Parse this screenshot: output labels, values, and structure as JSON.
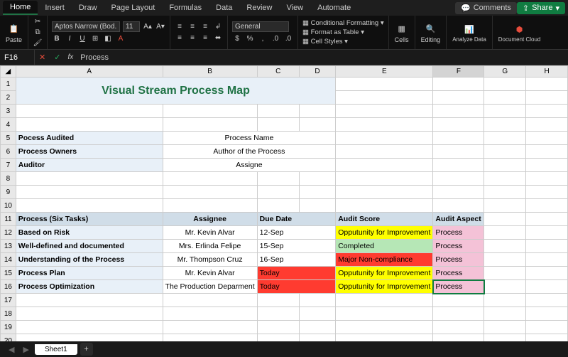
{
  "tabs": [
    "Home",
    "Insert",
    "Draw",
    "Page Layout",
    "Formulas",
    "Data",
    "Review",
    "View",
    "Automate"
  ],
  "buttons": {
    "comments": "Comments",
    "share": "Share",
    "paste": "Paste",
    "cells": "Cells",
    "editing": "Editing",
    "analyze": "Analyze Data",
    "doc": "Document Cloud"
  },
  "font": {
    "name": "Aptos Narrow (Bod...",
    "size": "11"
  },
  "numfmt": "General",
  "cond": {
    "cf": "Conditional Formatting",
    "ft": "Format as Table",
    "cs": "Cell Styles"
  },
  "cellref": "F16",
  "formula": "Process",
  "cols": [
    "A",
    "B",
    "C",
    "D",
    "E",
    "F",
    "G",
    "H"
  ],
  "title": "Visual Stream Process Map",
  "meta": [
    {
      "label": "Pocess Audited",
      "value": "Process Name"
    },
    {
      "label": "Process Owners",
      "value": "Author of the Process"
    },
    {
      "label": "Auditor",
      "value": "Assigne"
    }
  ],
  "hdr": {
    "proc": "Process (Six Tasks)",
    "asg": "Assignee",
    "due": "Due Date",
    "score": "Audit Score",
    "asp": "Audit Aspect"
  },
  "rows": [
    {
      "proc": "Based on Risk",
      "asg": "Mr. Kevin Alvar",
      "due": "12-Sep",
      "dueCls": "",
      "score": "Opputunity for Improvement",
      "scoreCls": "yellow",
      "asp": "Process"
    },
    {
      "proc": "Well-defined and documented",
      "asg": "Mrs. Erlinda Felipe",
      "due": "15-Sep",
      "dueCls": "",
      "score": "Completed",
      "scoreCls": "green",
      "asp": "Process"
    },
    {
      "proc": "Understanding of the Process",
      "asg": "Mr. Thompson Cruz",
      "due": "16-Sep",
      "dueCls": "",
      "score": "Major Non-compliance",
      "scoreCls": "red",
      "asp": "Process"
    },
    {
      "proc": "Process Plan",
      "asg": "Mr. Kevin Alvar",
      "due": "Today",
      "dueCls": "red",
      "score": "Opputunity for Improvement",
      "scoreCls": "yellow",
      "asp": "Process"
    },
    {
      "proc": "Process Optimization",
      "asg": "The Production Deparment",
      "due": "Today",
      "dueCls": "red",
      "score": "Opputunity for Improvement",
      "scoreCls": "yellow",
      "asp": "Process"
    }
  ],
  "sheet": "Sheet1"
}
